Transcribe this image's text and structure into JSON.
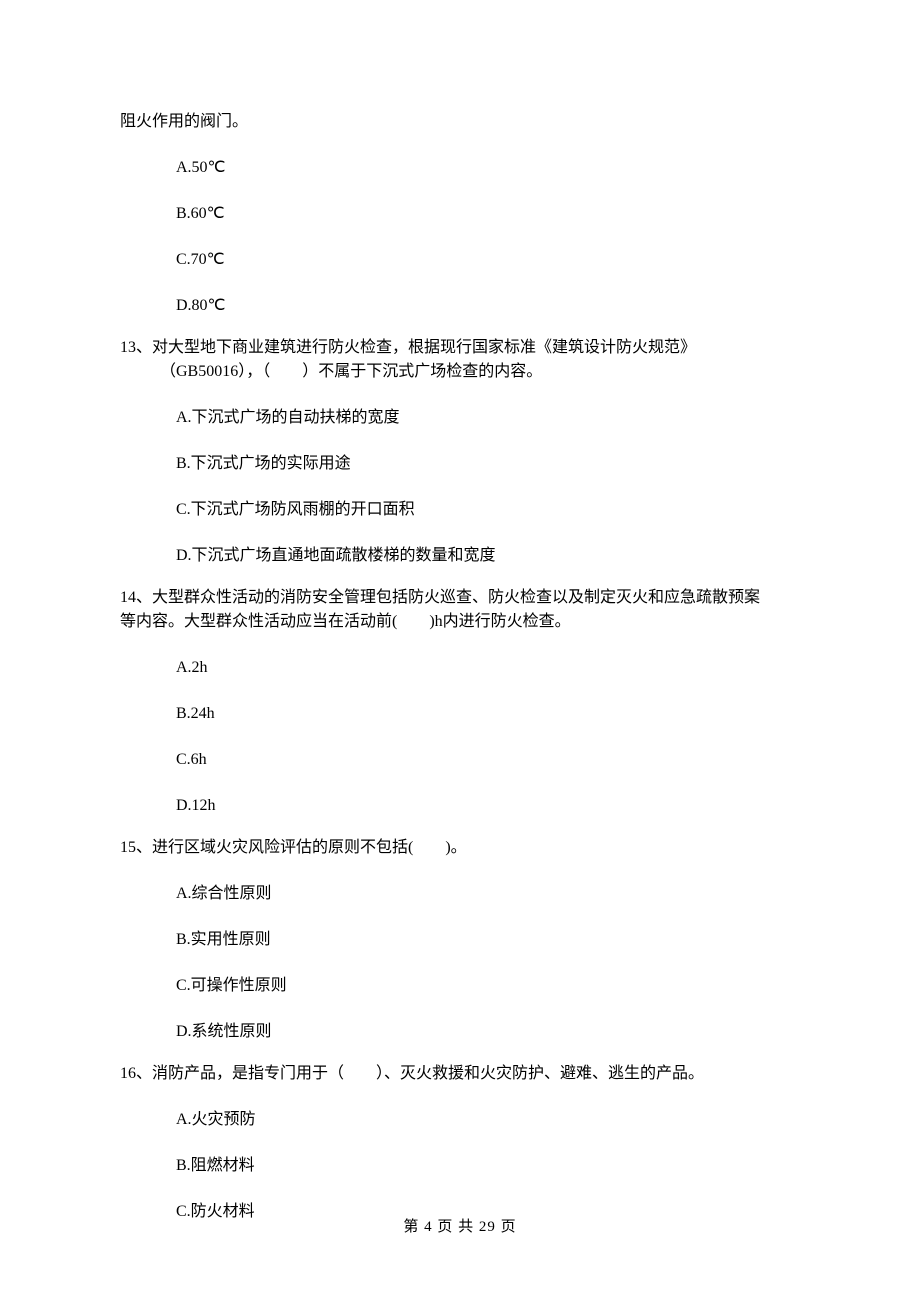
{
  "intro": "阻火作用的阀门。",
  "q12": {
    "options": {
      "A": "A.50℃",
      "B": "B.60℃",
      "C": "C.70℃",
      "D": "D.80℃"
    }
  },
  "q13": {
    "stem": "13、对大型地下商业建筑进行防火检查，根据现行国家标准《建筑设计防火规范》",
    "stem2": "（GB50016），（　　）不属于下沉式广场检查的内容。",
    "options": {
      "A": "A.下沉式广场的自动扶梯的宽度",
      "B": "B.下沉式广场的实际用途",
      "C": "C.下沉式广场防风雨棚的开口面积",
      "D": "D.下沉式广场直通地面疏散楼梯的数量和宽度"
    }
  },
  "q14": {
    "stem": "14、大型群众性活动的消防安全管理包括防火巡查、防火检查以及制定灭火和应急疏散预案",
    "stem2": "等内容。大型群众性活动应当在活动前(　　)h内进行防火检查。",
    "options": {
      "A": "A.2h",
      "B": "B.24h",
      "C": "C.6h",
      "D": "D.12h"
    }
  },
  "q15": {
    "stem": "15、进行区域火灾风险评估的原则不包括(　　)。",
    "options": {
      "A": "A.综合性原则",
      "B": "B.实用性原则",
      "C": "C.可操作性原则",
      "D": "D.系统性原则"
    }
  },
  "q16": {
    "stem": "16、消防产品，是指专门用于（　　）、灭火救援和火灾防护、避难、逃生的产品。",
    "options": {
      "A": "A.火灾预防",
      "B": "B.阻燃材料",
      "C": "C.防火材料"
    }
  },
  "footer": "第 4 页 共 29 页"
}
